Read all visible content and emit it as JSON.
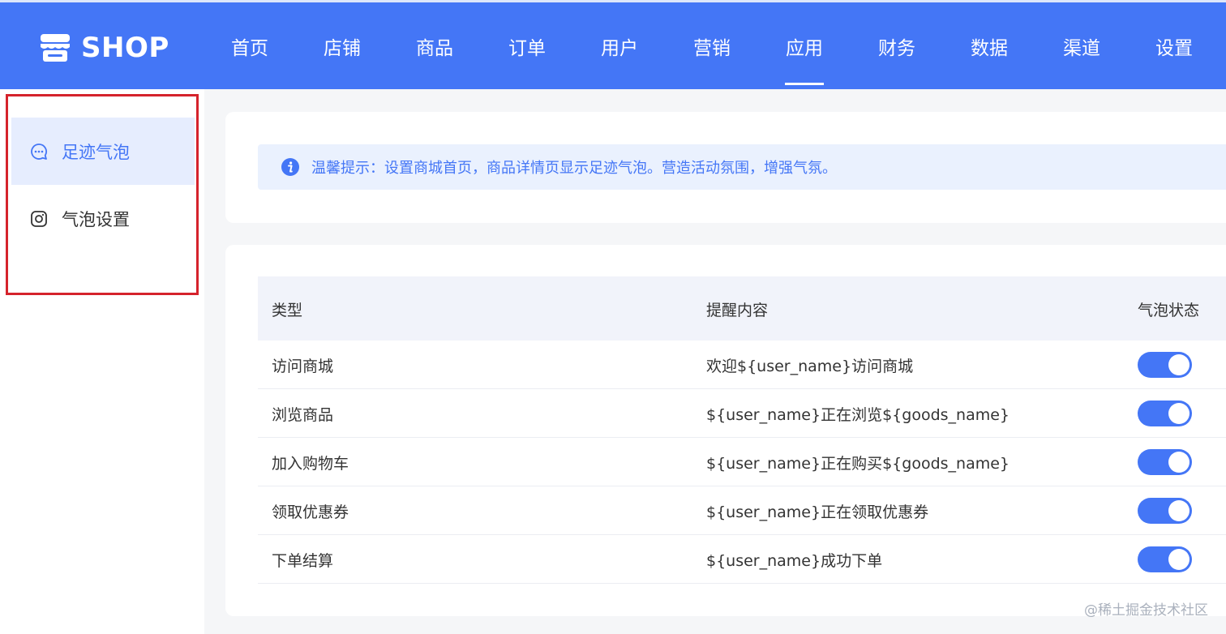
{
  "brand": {
    "name": "SHOP",
    "icon": "shop-icon"
  },
  "nav": [
    {
      "label": "首页",
      "active": false
    },
    {
      "label": "店铺",
      "active": false
    },
    {
      "label": "商品",
      "active": false
    },
    {
      "label": "订单",
      "active": false
    },
    {
      "label": "用户",
      "active": false
    },
    {
      "label": "营销",
      "active": false
    },
    {
      "label": "应用",
      "active": true
    },
    {
      "label": "财务",
      "active": false
    },
    {
      "label": "数据",
      "active": false
    },
    {
      "label": "渠道",
      "active": false
    },
    {
      "label": "设置",
      "active": false
    }
  ],
  "sidebar": {
    "items": [
      {
        "label": "足迹气泡",
        "icon": "chat-bubble-icon",
        "active": true
      },
      {
        "label": "气泡设置",
        "icon": "settings-square-icon",
        "active": false
      }
    ]
  },
  "tip": {
    "icon": "info-icon",
    "text": "温馨提示：设置商城首页，商品详情页显示足迹气泡。营造活动氛围，增强气氛。"
  },
  "table": {
    "headers": [
      "类型",
      "提醒内容",
      "气泡状态"
    ],
    "rows": [
      {
        "type": "访问商城",
        "content": "欢迎${user_name}访问商城",
        "enabled": true
      },
      {
        "type": "浏览商品",
        "content": "${user_name}正在浏览${goods_name}",
        "enabled": true
      },
      {
        "type": "加入购物车",
        "content": "${user_name}正在购买${goods_name}",
        "enabled": true
      },
      {
        "type": "领取优惠券",
        "content": "${user_name}正在领取优惠券",
        "enabled": true
      },
      {
        "type": "下单结算",
        "content": "${user_name}成功下单",
        "enabled": true
      }
    ]
  },
  "watermark": "@稀土掘金技术社区",
  "colors": {
    "primary": "#4476f6",
    "highlight_border": "#d5232c",
    "tip_bg": "#eaf1fe"
  }
}
